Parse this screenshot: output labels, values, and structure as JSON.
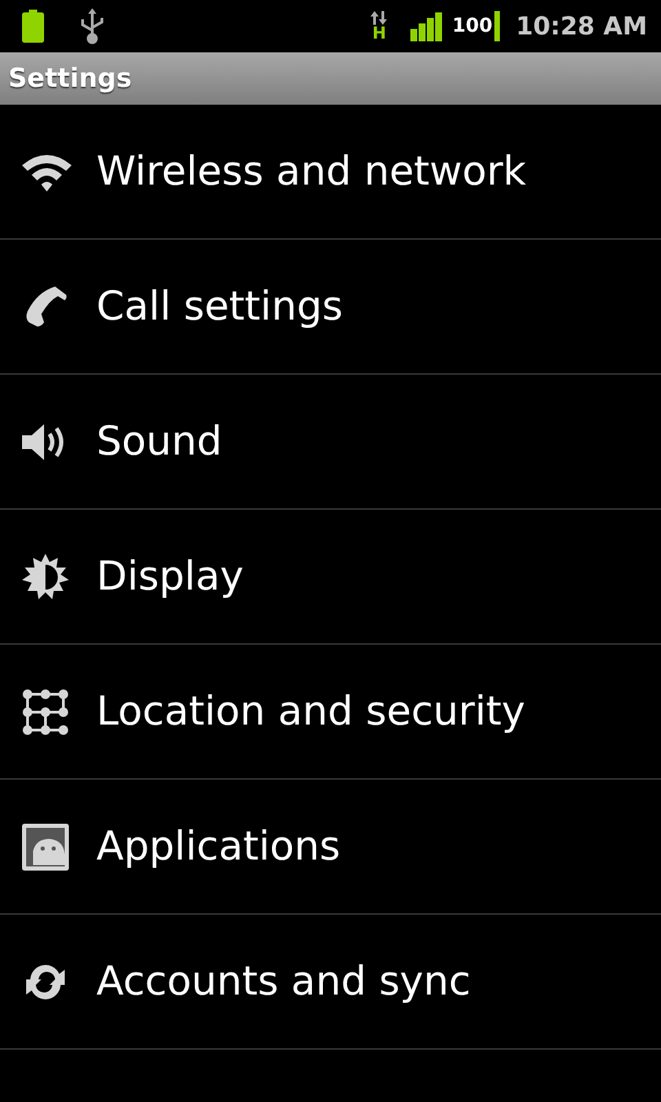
{
  "status_bar": {
    "network_type": "H",
    "signal_strength": "100",
    "time": "10:28 AM"
  },
  "title": "Settings",
  "items": [
    {
      "kind": "wifi",
      "label": "Wireless and network"
    },
    {
      "kind": "phone",
      "label": "Call settings"
    },
    {
      "kind": "sound",
      "label": "Sound"
    },
    {
      "kind": "display",
      "label": "Display"
    },
    {
      "kind": "pattern",
      "label": "Location and security"
    },
    {
      "kind": "apps",
      "label": "Applications"
    },
    {
      "kind": "sync",
      "label": "Accounts and sync"
    }
  ]
}
